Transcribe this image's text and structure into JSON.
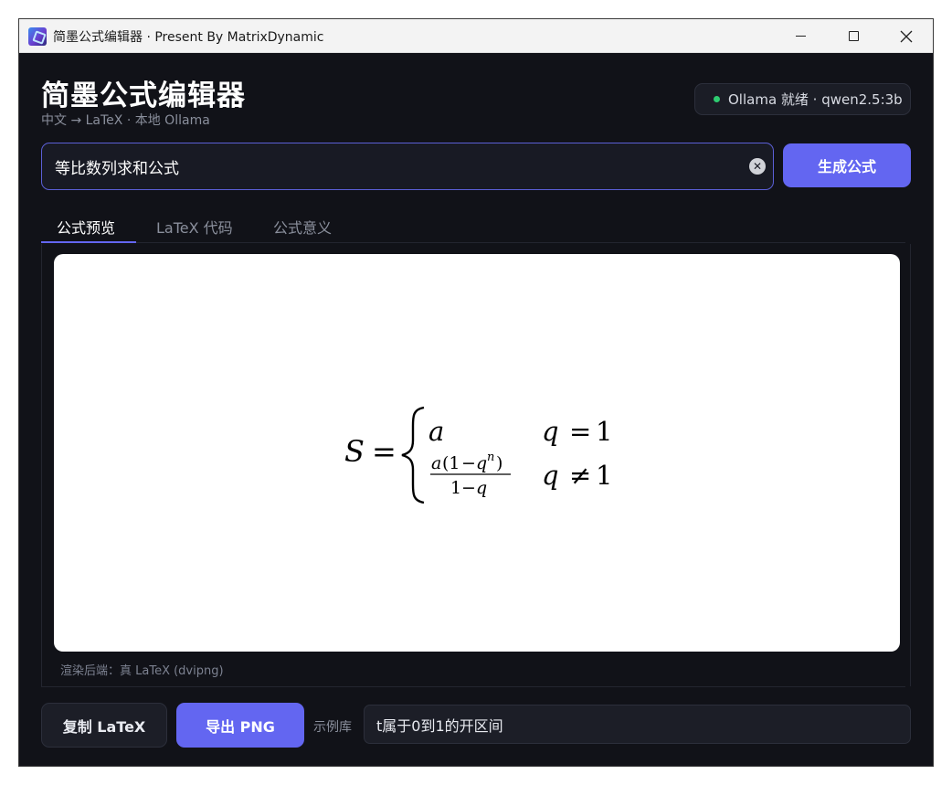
{
  "window": {
    "title": "简墨公式编辑器 · Present By MatrixDynamic",
    "icon": "app-logo-icon"
  },
  "header": {
    "title": "简墨公式编辑器",
    "subtitle": "中文 → LaTeX · 本地 Ollama",
    "status": {
      "text": "Ollama 就绪 · qwen2.5:3b",
      "color": "#2ecc71"
    }
  },
  "search": {
    "value": "等比数列求和公式",
    "clear_icon": "clear-icon"
  },
  "generate_button": {
    "label": "生成公式"
  },
  "tabs": [
    {
      "label": "公式预览",
      "active": true
    },
    {
      "label": "LaTeX 代码",
      "active": false
    },
    {
      "label": "公式意义",
      "active": false
    }
  ],
  "preview": {
    "formula": {
      "lhs": "S",
      "equals": "=",
      "cases": [
        {
          "value": "a",
          "condition_var": "q",
          "condition_op": "=",
          "condition_rhs": "1"
        },
        {
          "numerator_a": "a",
          "numerator_paren_open": "(1",
          "numerator_minus": "−",
          "numerator_q": "q",
          "numerator_exp": "n",
          "numerator_paren_close": ")",
          "denominator_one": "1",
          "denominator_minus": "−",
          "denominator_q": "q",
          "condition_var": "q",
          "condition_op": "≠",
          "condition_rhs": "1"
        }
      ]
    },
    "backend_note": "渲染后端：真 LaTeX (dvipng)"
  },
  "footer": {
    "copy_label": "复制 LaTeX",
    "export_label": "导出 PNG",
    "examples_label": "示例库",
    "examples_selected": "t属于0到1的开区间"
  },
  "colors": {
    "accent": "#6366f1",
    "background": "#111218",
    "status_ok": "#2ecc71"
  }
}
